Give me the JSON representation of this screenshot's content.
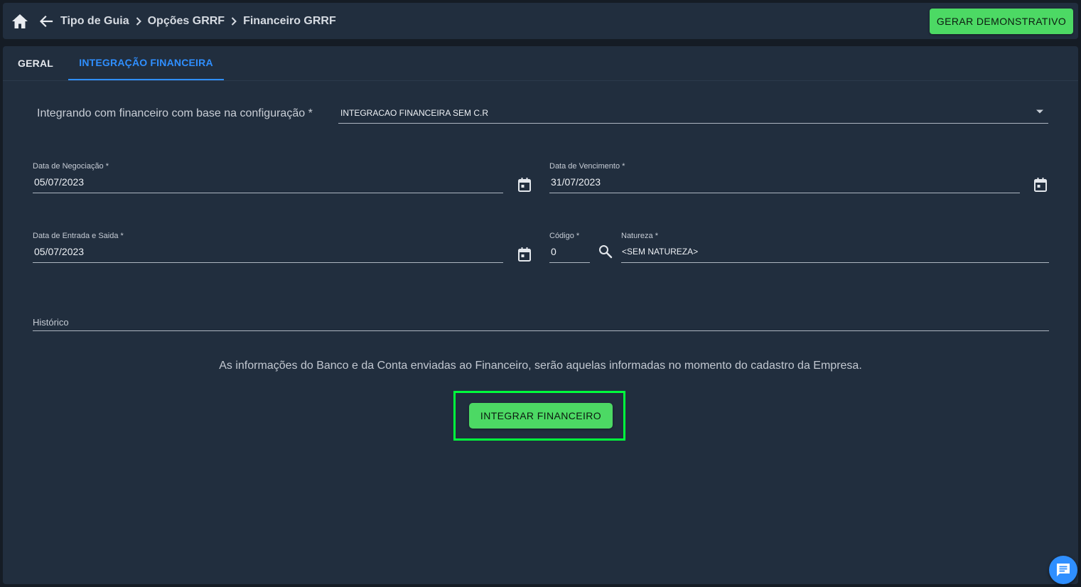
{
  "header": {
    "breadcrumbs": [
      "Tipo de Guia",
      "Opções GRRF",
      "Financeiro GRRF"
    ],
    "generate_button": "GERAR DEMONSTRATIVO"
  },
  "tabs": [
    {
      "label": "GERAL",
      "active": false
    },
    {
      "label": "INTEGRAÇÃO FINANCEIRA",
      "active": true
    }
  ],
  "form": {
    "config_label": "Integrando com financeiro com base na configuração *",
    "config_value": "INTEGRACAO FINANCEIRA SEM C.R",
    "data_negociacao": {
      "label": "Data de Negociação *",
      "value": "05/07/2023"
    },
    "data_vencimento": {
      "label": "Data de Vencimento *",
      "value": "31/07/2023"
    },
    "data_entrada_saida": {
      "label": "Data de Entrada e Saida *",
      "value": "05/07/2023"
    },
    "codigo": {
      "label": "Código *",
      "value": "0"
    },
    "natureza": {
      "label": "Natureza *",
      "value": "<SEM NATUREZA>"
    },
    "historico": {
      "label": "Histórico",
      "value": ""
    }
  },
  "info_text": "As informações do Banco e da Conta enviadas ao Financeiro, serão aquelas informadas no momento do cadastro da Empresa.",
  "integrate_button": "INTEGRAR FINANCEIRO",
  "colors": {
    "accent_green": "#4cd964",
    "tab_active": "#2f8fff",
    "highlight": "#00ff3c",
    "panel_bg": "#212e3e"
  },
  "icons": [
    "home-icon",
    "back-arrow-icon",
    "chevron-right-icon",
    "calendar-icon",
    "search-icon",
    "dropdown-arrow-icon",
    "chat-icon"
  ]
}
